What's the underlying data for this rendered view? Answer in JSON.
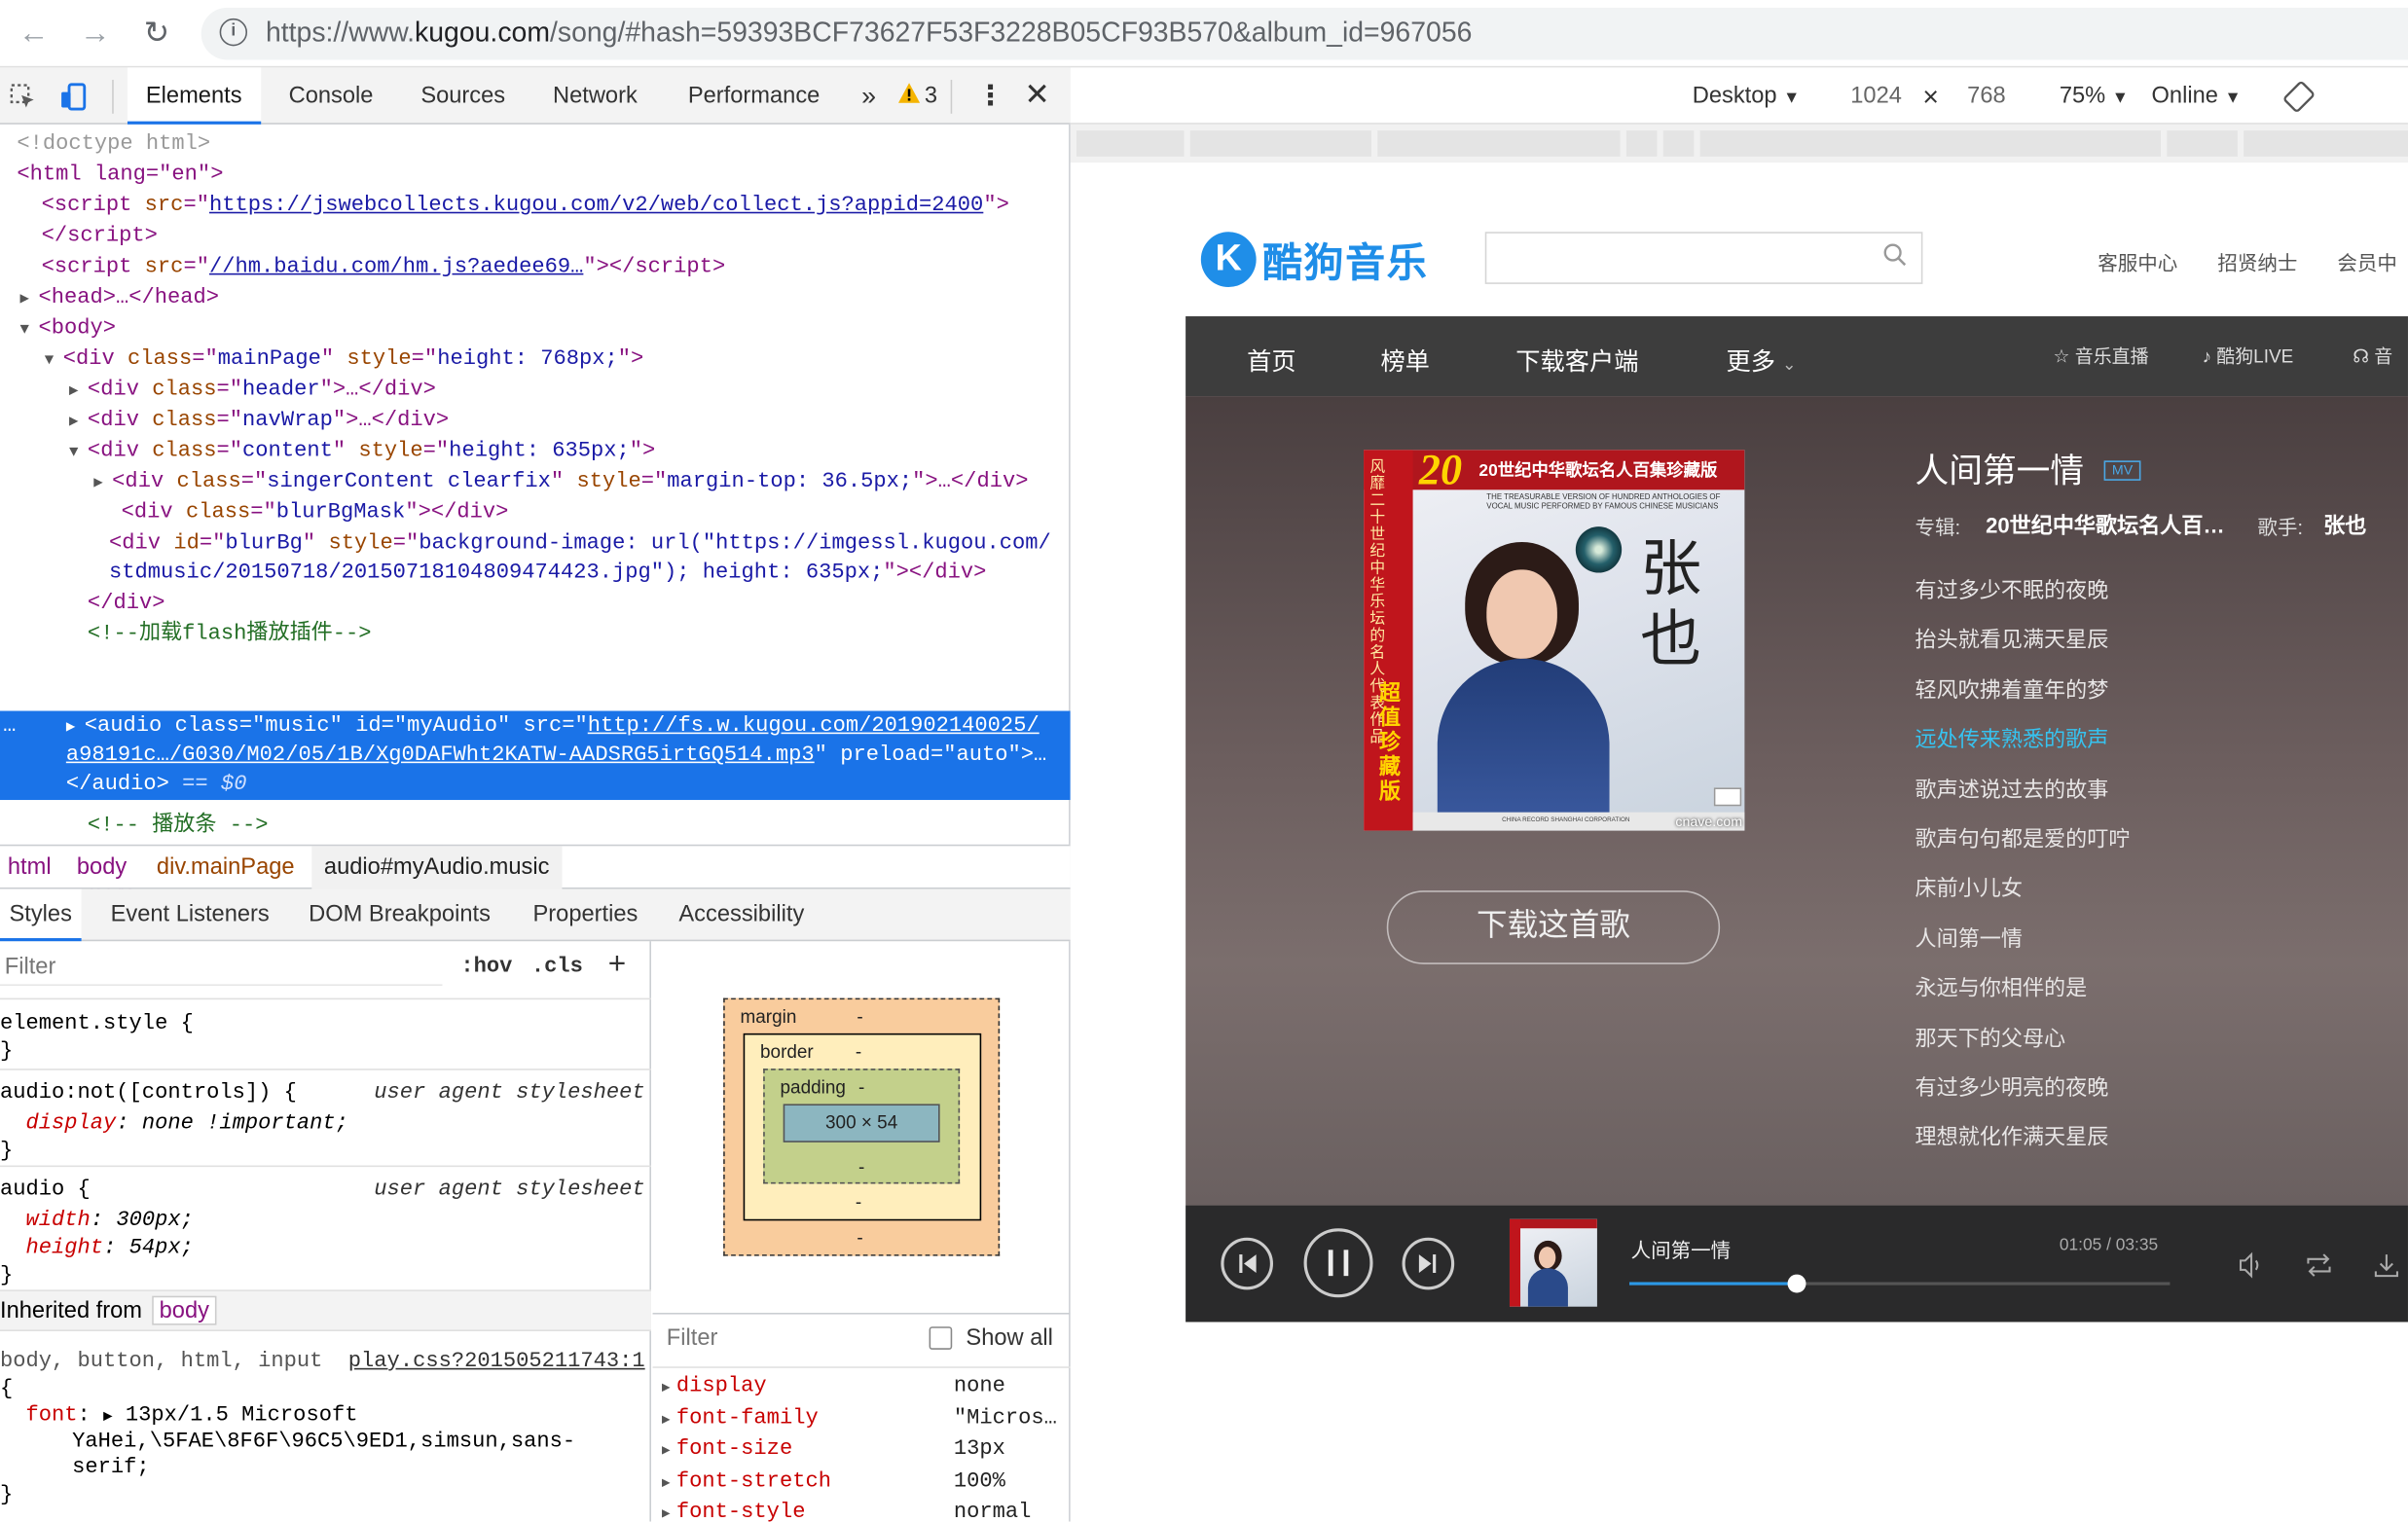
{
  "browser": {
    "url_prefix": "https://www.",
    "url_host": "kugou.com",
    "url_path": "/song/#hash=59393BCF73627F53F3228B05CF93B570&album_id=967056"
  },
  "devtools": {
    "tabs": [
      "Elements",
      "Console",
      "Sources",
      "Network",
      "Performance"
    ],
    "more": "»",
    "warning_count": "3",
    "dom": {
      "doctype": "<!doctype html>",
      "html_open": "<html lang=\"en\">",
      "script1_src": "https://jswebcollects.kugou.com/v2/web/collect.js?appid=2400",
      "script2_src": "//hm.baidu.com/hm.js?aedee69…",
      "comment_flash": "<!--加载flash播放插件-->",
      "audio_src1": "http://fs.w.kugou.com/201902140025/",
      "audio_src2": "a98191c…/G030/M02/05/1B/Xg0DAFWht2KATW-AADSRG5irtGQ514.mp3",
      "audio_eq": "== $0",
      "comment_player": "<!-- 播放条 -->",
      "blurbg_style1": "background-image: url(\"https://imgessl.kugou.com/",
      "blurbg_style2": "stdmusic/20150718/20150718104809474423.jpg\"); height: 635px;"
    },
    "breadcrumbs": [
      "html",
      "body",
      "div.mainPage",
      "audio#myAudio.music"
    ],
    "subtabs": [
      "Styles",
      "Event Listeners",
      "DOM Breakpoints",
      "Properties",
      "Accessibility"
    ],
    "filter_placeholder": "Filter",
    "hov": ":hov",
    "cls": ".cls",
    "styles": {
      "element_style": "element.style {",
      "rule1_selector": "audio:not([controls]) {",
      "rule1_source": "user agent stylesheet",
      "rule1_prop": "display",
      "rule1_val": "none !important;",
      "rule2_selector": "audio {",
      "rule2_source": "user agent stylesheet",
      "width_prop": "width",
      "width_val": "300px;",
      "height_prop": "height",
      "height_val": "54px;",
      "inherited_label": "Inherited from",
      "inherited_tag": "body",
      "rule3_selector": "body, button, html, input",
      "rule3_source": "play.css?201505211743:1",
      "font_prop": "font",
      "font_val1": "13px/1.5 Microsoft",
      "font_val2": "YaHei,\\5FAE\\8F6F\\96C5\\9ED1,simsun,sans-",
      "font_val3": "serif;"
    },
    "boxmodel": {
      "margin": "margin",
      "border": "border",
      "padding": "padding",
      "dash": "-",
      "content": "300 × 54"
    },
    "computed": {
      "filter": "Filter",
      "show_all": "Show all",
      "rows": [
        {
          "prop": "display",
          "val": "none"
        },
        {
          "prop": "font-family",
          "val": "\"Micros…"
        },
        {
          "prop": "font-size",
          "val": "13px"
        },
        {
          "prop": "font-stretch",
          "val": "100%"
        },
        {
          "prop": "font-style",
          "val": "normal"
        }
      ]
    }
  },
  "device": {
    "preset": "Desktop",
    "width": "1024",
    "times": "×",
    "height": "768",
    "zoom": "75%",
    "network": "Online"
  },
  "kugou": {
    "logo_text": "酷狗音乐",
    "header_links": [
      "客服中心",
      "招贤纳士",
      "会员中"
    ],
    "nav": [
      "首页",
      "榜单",
      "下载客户端",
      "更多"
    ],
    "nav_right": [
      "音乐直播",
      "酷狗LIVE",
      "音"
    ],
    "song_title": "人间第一情",
    "mv_badge": "MV",
    "album_label": "专辑:",
    "album_name": "20世纪中华歌坛名人百…",
    "singer_label": "歌手:",
    "singer_name": "张也",
    "download_btn": "下载这首歌",
    "lyrics": [
      "有过多少不眠的夜晚",
      "抬头就看见满天星辰",
      "轻风吹拂着童年的梦",
      "远处传来熟悉的歌声",
      "歌声述说过去的故事",
      "歌声句句都是爱的叮咛",
      "床前小儿女",
      "人间第一情",
      "永远与你相伴的是",
      "那天下的父母心",
      "有过多少明亮的夜晚",
      "理想就化作满天星辰"
    ],
    "lyric_active_index": 3,
    "cover": {
      "banner": "20世纪中华歌坛名人百集珍藏版",
      "subtitle1": "THE TREASURABLE VERSION OF HUNDRED ANTHOLOGIES OF",
      "subtitle2": "VOCAL MUSIC PERFORMED BY FAMOUS CHINESE MUSICIANS",
      "side_text": "风靡二十世纪中华乐坛的名人代表作品",
      "collect": "超值珍藏版",
      "name": "张也",
      "watermark": "cnave.com",
      "bottom": "CHINA RECORD SHANGHAI CORPORATION"
    },
    "player": {
      "title": "人间第一情",
      "time": "01:05 / 03:35",
      "progress": 0.31
    }
  },
  "colors": {
    "devtools_selection": "#1a73e8",
    "kugou_blue": "#1f8ee8",
    "lyric_active": "#36c3f0"
  }
}
